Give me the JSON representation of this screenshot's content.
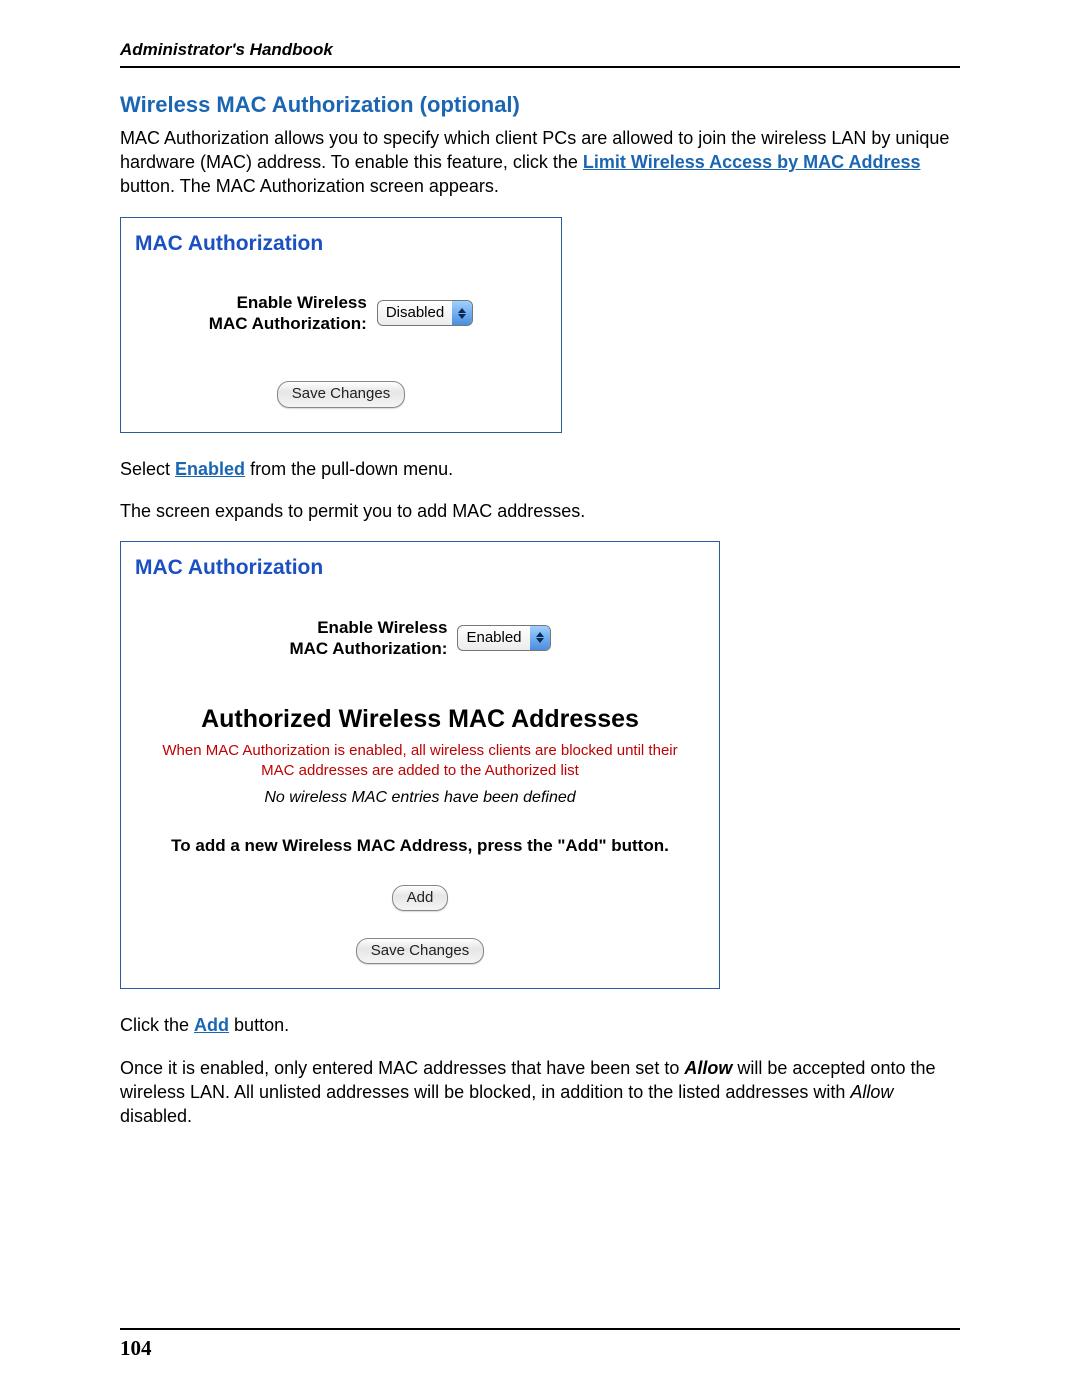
{
  "header": {
    "book_title": "Administrator's Handbook"
  },
  "section": {
    "heading": "Wireless MAC Authorization (optional)",
    "intro_before_link": "MAC Authorization allows you to specify which client PCs are allowed to join the wireless LAN by unique hardware (MAC) address. To enable this feature, click the ",
    "intro_link": "Limit Wireless Access by MAC Address",
    "intro_after_link": " button. The MAC Authorization screen appears."
  },
  "panel1": {
    "title": "MAC Authorization",
    "field_label_line1": "Enable Wireless",
    "field_label_line2": "MAC Authorization:",
    "dropdown_value": "Disabled",
    "save_button": "Save Changes"
  },
  "mid_text": {
    "before_link": "Select ",
    "link": "Enabled",
    "after_link": " from the pull-down menu.",
    "expands": "The screen expands to permit you to add MAC addresses."
  },
  "panel2": {
    "title": "MAC Authorization",
    "field_label_line1": "Enable Wireless",
    "field_label_line2": "MAC Authorization:",
    "dropdown_value": "Enabled",
    "sub_heading": "Authorized Wireless MAC Addresses",
    "warning": "When MAC Authorization is enabled, all wireless clients are blocked until their MAC addresses are added to the Authorized list",
    "empty_msg": "No wireless MAC entries have been defined",
    "add_instruction": "To add a new Wireless MAC Address, press the \"Add\" button.",
    "add_button": "Add",
    "save_button": "Save Changes"
  },
  "closing": {
    "click_before": "Click the ",
    "click_link": "Add",
    "click_after": " button.",
    "final_prefix": "Once it is enabled, only entered MAC addresses that have been set to ",
    "final_allow_bi": "Allow",
    "final_mid": " will be accepted onto the wireless LAN. All unlisted addresses will be blocked, in addition to the listed addresses with ",
    "final_allow_it": "Allow",
    "final_suffix": " disabled."
  },
  "page_number": "104"
}
